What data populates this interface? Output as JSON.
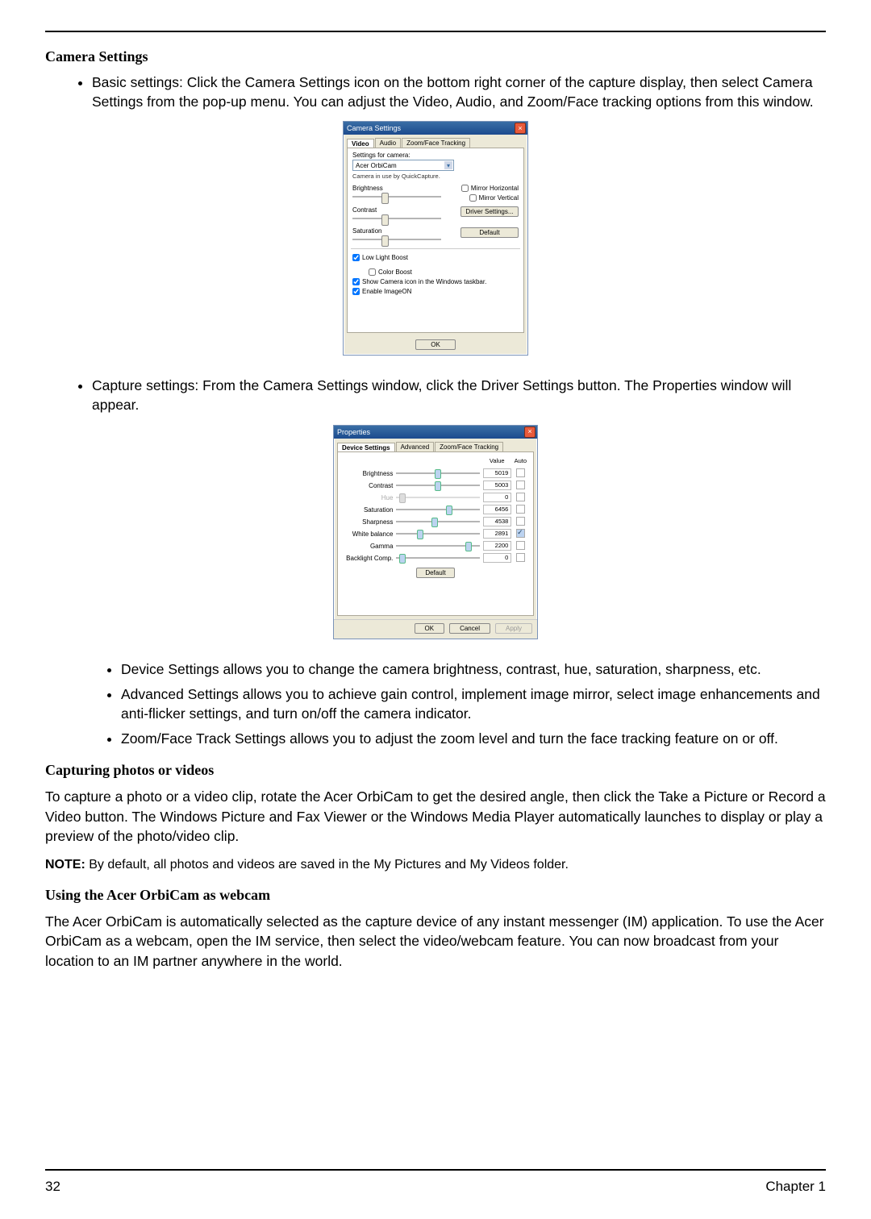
{
  "footer": {
    "page_number": "32",
    "chapter": "Chapter 1"
  },
  "sections": {
    "camera_settings_heading": "Camera Settings",
    "basic_settings": "Basic settings: Click the Camera Settings icon on the bottom right corner of the capture display, then select Camera Settings from the pop-up menu. You can adjust the Video, Audio, and Zoom/Face tracking options from this window.",
    "capture_settings": "Capture settings: From the Camera Settings window, click the Driver Settings button. The Properties window will appear.",
    "sub_bullets": {
      "device": "Device Settings allows you to change the camera brightness, contrast, hue, saturation, sharpness, etc.",
      "advanced": "Advanced Settings allows you to achieve gain control, implement image mirror, select image enhancements and anti-flicker settings, and turn on/off the camera indicator.",
      "zoom": "Zoom/Face Track Settings allows you to adjust the zoom level and turn the face tracking feature on or off."
    },
    "capturing_heading": "Capturing photos or videos",
    "capturing_body": "To capture a photo or a video clip, rotate the Acer OrbiCam to get the desired angle, then click the Take a Picture or Record a Video button. The Windows Picture and Fax Viewer or the Windows Media Player automatically launches to display or play a preview of the photo/video clip.",
    "note_label": "NOTE:",
    "note_body": " By default, all photos and videos are saved in the My Pictures and My Videos folder.",
    "webcam_heading": "Using the Acer OrbiCam as webcam",
    "webcam_body": "The Acer OrbiCam is automatically selected as the capture device of any instant messenger (IM) application. To use the Acer OrbiCam as a webcam, open the IM service, then select the video/webcam feature. You can now broadcast from your location to an IM partner anywhere in the world."
  },
  "dialog_camera": {
    "title": "Camera Settings",
    "tabs": {
      "video": "Video",
      "audio": "Audio",
      "zoom": "Zoom/Face Tracking"
    },
    "settings_for": "Settings for camera:",
    "device": "Acer OrbiCam",
    "device_note": "Camera in use by QuickCapture.",
    "brightness": "Brightness",
    "contrast": "Contrast",
    "saturation": "Saturation",
    "mirror_h": "Mirror Horizontal",
    "mirror_v": "Mirror Vertical",
    "driver_btn": "Driver Settings...",
    "default_btn": "Default",
    "low_light": "Low Light Boost",
    "color_boost": "Color Boost",
    "taskbar": "Show Camera icon in the Windows taskbar.",
    "image_on": "Enable ImageON",
    "ok": "OK"
  },
  "dialog_props": {
    "title": "Properties",
    "tabs": {
      "device": "Device Settings",
      "advanced": "Advanced",
      "zoom": "Zoom/Face Tracking"
    },
    "hdr_value": "Value",
    "hdr_auto": "Auto",
    "rows": {
      "brightness": {
        "label": "Brightness",
        "value": "5019"
      },
      "contrast": {
        "label": "Contrast",
        "value": "5003"
      },
      "hue": {
        "label": "Hue",
        "value": "0"
      },
      "saturation": {
        "label": "Saturation",
        "value": "6456"
      },
      "sharpness": {
        "label": "Sharpness",
        "value": "4538"
      },
      "whitebalance": {
        "label": "White balance",
        "value": "2891"
      },
      "gamma": {
        "label": "Gamma",
        "value": "2200"
      },
      "backlight": {
        "label": "Backlight Comp.",
        "value": "0"
      }
    },
    "default_btn": "Default",
    "ok": "OK",
    "cancel": "Cancel",
    "apply": "Apply"
  }
}
